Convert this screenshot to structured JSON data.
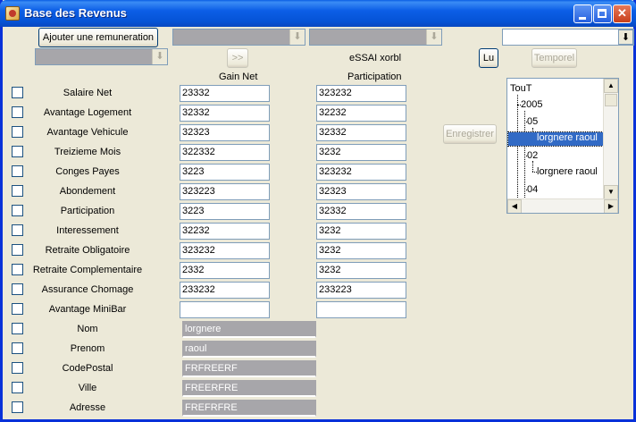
{
  "window": {
    "title": "Base des Revenus"
  },
  "toolbar": {
    "add_label": "Ajouter une remuneration",
    "next_label": ">>",
    "essai_label": "eSSAI xorbl",
    "lu_label": "Lu",
    "temporel_label": "Temporel",
    "enregistrer_label": "Enregistrer"
  },
  "headers": {
    "gain_net": "Gain Net",
    "participation": "Participation"
  },
  "rows": [
    {
      "label": "Salaire Net",
      "gain": "23332",
      "part": "323232"
    },
    {
      "label": "Avantage Logement",
      "gain": "32332",
      "part": "32232"
    },
    {
      "label": "Avantage Vehicule",
      "gain": "32323",
      "part": "32332"
    },
    {
      "label": "Treizieme Mois",
      "gain": "322332",
      "part": "3232"
    },
    {
      "label": "Conges Payes",
      "gain": "3223",
      "part": "323232"
    },
    {
      "label": "Abondement",
      "gain": "323223",
      "part": "32323"
    },
    {
      "label": "Participation",
      "gain": "3223",
      "part": "32332"
    },
    {
      "label": "Interessement",
      "gain": "32232",
      "part": "3232"
    },
    {
      "label": "Retraite Obligatoire",
      "gain": "323232",
      "part": "3232"
    },
    {
      "label": "Retraite Complementaire",
      "gain": "2332",
      "part": "3232"
    },
    {
      "label": "Assurance Chomage",
      "gain": "233232",
      "part": "233223"
    },
    {
      "label": "Avantage MiniBar",
      "gain": "",
      "part": ""
    }
  ],
  "identity": [
    {
      "label": "Nom",
      "value": "lorgnere"
    },
    {
      "label": "Prenom",
      "value": "raoul"
    },
    {
      "label": "CodePostal",
      "value": "FRFREERF"
    },
    {
      "label": "Ville",
      "value": "FREERFRE"
    },
    {
      "label": "Adresse",
      "value": "FREFRFRE"
    }
  ],
  "tree": {
    "root": "TouT",
    "year": "2005",
    "month1": "05",
    "person1": "lorgnere raoul",
    "month2": "02",
    "person2": "lorgnere raoul",
    "month3": "04"
  },
  "icons": {
    "dropdown": "download-arrow-icon",
    "minimize": "minimize-icon",
    "maximize": "maximize-icon",
    "close": "close-icon"
  },
  "colors": {
    "titlebar": "#0553d6",
    "selection": "#316ac5",
    "window_bg": "#ece9d8"
  }
}
